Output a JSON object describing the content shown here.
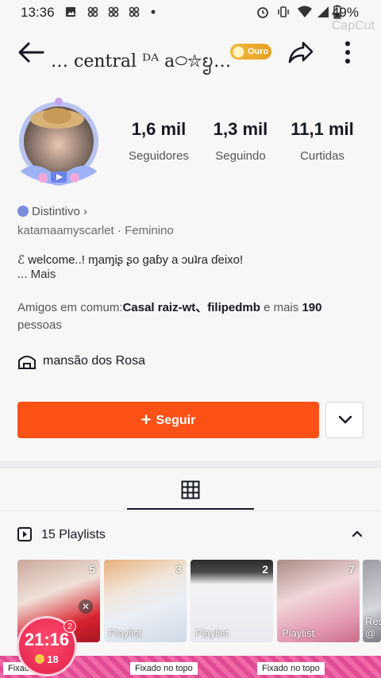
{
  "status_bar": {
    "time": "13:36",
    "battery": "49%",
    "watermark": "CapCut"
  },
  "header": {
    "title": "… central ᴰᴬ a࿀⛦ᨮ…",
    "badge": "Ouro"
  },
  "stats": [
    {
      "value": "1,6 mil",
      "label": "Seguidores"
    },
    {
      "value": "1,3 mil",
      "label": "Seguindo"
    },
    {
      "value": "11,1 mil",
      "label": "Curtidas"
    }
  ],
  "profile": {
    "distintivo": "Distintivo",
    "username": "katamaamyscarlet",
    "gender": "Feminino",
    "bio": "ℰ ᴡelcome..! ɱaɱiʂ ʂo ɡaɓy a ɔuʇra ɗeiхo!",
    "mais": "...  Mais",
    "amigos_prefix": "Amigos em comum:",
    "amigos_names": "Casal raiz-wt、filipedmb",
    "amigos_mid": " e mais ",
    "amigos_count": "190",
    "amigos_suffix": "pessoas",
    "location": "mansão dos Rosa"
  },
  "follow_button": "Seguir",
  "playlists": {
    "label": "15 Playlists",
    "items": [
      {
        "count": "5",
        "label": ""
      },
      {
        "count": "3",
        "label": "Playlist"
      },
      {
        "count": "2",
        "label": "Playlist"
      },
      {
        "count": "7",
        "label": "Playlist"
      },
      {
        "count": "",
        "label": "Res @"
      }
    ]
  },
  "pinned": [
    "Fixado",
    "Fixado no topo",
    "Fixado no topo"
  ],
  "timer": {
    "time": "21:16",
    "coins": "18",
    "notif": "2"
  },
  "colors": {
    "accent": "#fe5116",
    "badge_gold": "#f0b83c"
  }
}
